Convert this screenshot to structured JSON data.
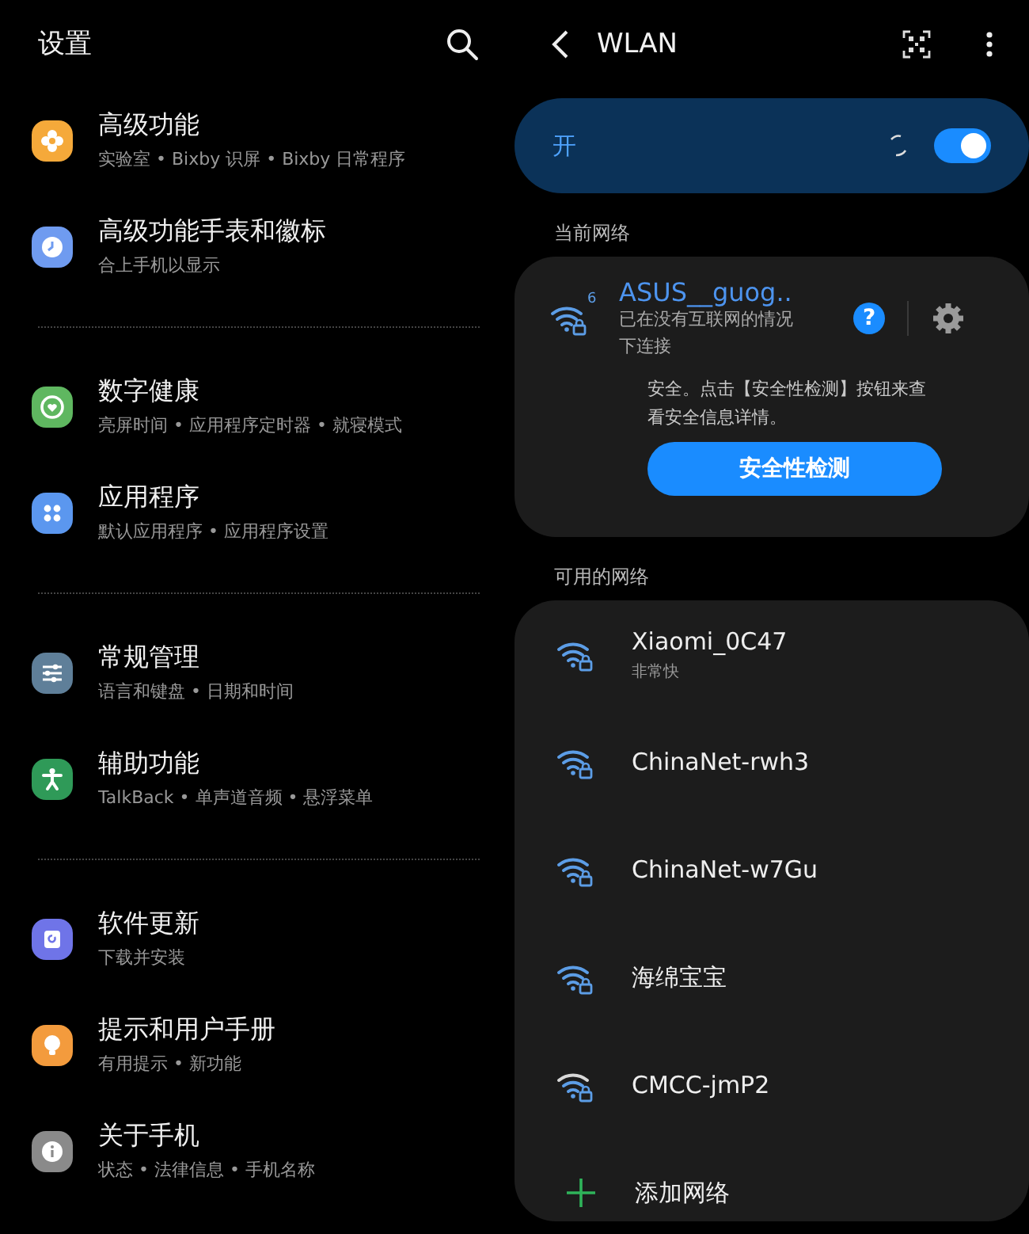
{
  "settings": {
    "title": "设置",
    "groups": [
      [
        {
          "kind": "flower",
          "color": "#f5a93a",
          "title": "高级功能",
          "subtitle": "实验室 • Bixby 识屏 • Bixby 日常程序"
        },
        {
          "kind": "clock",
          "color": "#6f9bf0",
          "title": "高级功能手表和徽标",
          "subtitle": "合上手机以显示"
        }
      ],
      [
        {
          "kind": "heart",
          "color": "#5fb760",
          "title": "数字健康",
          "subtitle": "亮屏时间 • 应用程序定时器 • 就寝模式"
        },
        {
          "kind": "dots",
          "color": "#5b97ef",
          "title": "应用程序",
          "subtitle": "默认应用程序 • 应用程序设置"
        }
      ],
      [
        {
          "kind": "sliders",
          "color": "#5f7f99",
          "title": "常规管理",
          "subtitle": "语言和键盘 • 日期和时间"
        },
        {
          "kind": "person",
          "color": "#2f9a58",
          "title": "辅助功能",
          "subtitle": "TalkBack • 单声道音频 • 悬浮菜单"
        }
      ],
      [
        {
          "kind": "refresh",
          "color": "#6f74e8",
          "title": "软件更新",
          "subtitle": "下载并安装"
        },
        {
          "kind": "bulb",
          "color": "#f39b3d",
          "title": "提示和用户手册",
          "subtitle": "有用提示 • 新功能"
        },
        {
          "kind": "info",
          "color": "#8a8a8a",
          "title": "关于手机",
          "subtitle": "状态 • 法律信息 • 手机名称"
        }
      ]
    ]
  },
  "wlan": {
    "title": "WLAN",
    "master": {
      "label": "开",
      "on": true
    },
    "current_header": "当前网络",
    "current": {
      "name": "ASUS__guog..",
      "badge": "6",
      "status": "已在没有互联网的情况下连接",
      "note": "安全。点击【安全性检测】按钮来查看安全信息详情。",
      "button": "安全性检测",
      "help": "?"
    },
    "available_header": "可用的网络",
    "networks": [
      {
        "name": "Xiaomi_0C47",
        "detail": "非常快"
      },
      {
        "name": "ChinaNet-rwh3"
      },
      {
        "name": "ChinaNet-w7Gu"
      },
      {
        "name": "海绵宝宝"
      },
      {
        "name": "CMCC-jmP2"
      }
    ],
    "add": "添加网络"
  }
}
